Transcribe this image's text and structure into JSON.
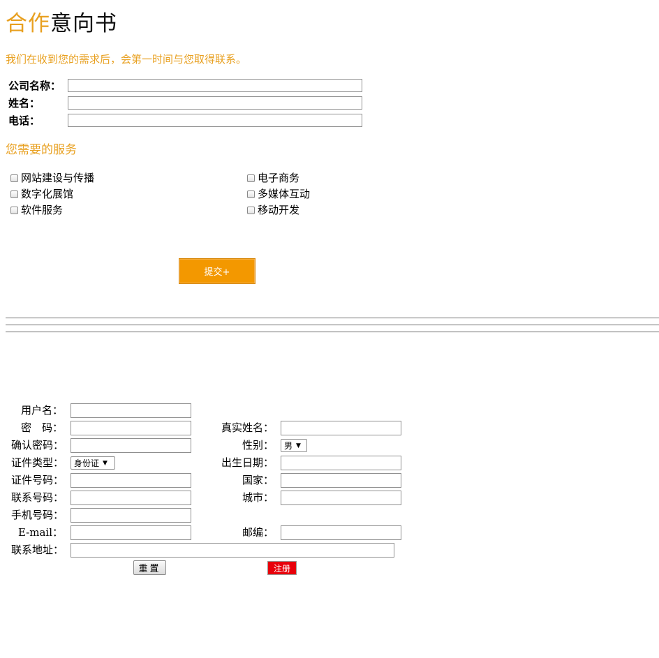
{
  "header": {
    "title_accent": "合作",
    "title_rest": "意向书",
    "subtitle": "我们在收到您的需求后，会第一时间与您取得联系。"
  },
  "contact_form": {
    "company_label": "公司名称：",
    "name_label": "姓名：",
    "phone_label": "电话：",
    "company_value": "",
    "name_value": "",
    "phone_value": ""
  },
  "services": {
    "heading": "您需要的服务",
    "options": [
      "网站建设与传播",
      "电子商务",
      "数字化展馆",
      "多媒体互动",
      "软件服务",
      "移动开发"
    ],
    "submit_label": "提交+"
  },
  "register_form": {
    "username_label": "用户名：",
    "password_label": "密　码：",
    "realname_label": "真实姓名：",
    "confirm_label": "确认密码：",
    "gender_label": "性别：",
    "gender_value": "男",
    "idtype_label": "证件类型：",
    "idtype_value": "身份证",
    "birthdate_label": "出生日期：",
    "idnumber_label": "证件号码：",
    "country_label": "国家：",
    "contactnum_label": "联系号码：",
    "city_label": "城市：",
    "mobile_label": "手机号码：",
    "email_label": "E-mail：",
    "postcode_label": "邮编：",
    "address_label": "联系地址：",
    "reset_label": "重置",
    "register_label": "注册"
  },
  "colors": {
    "accent": "#e8a020",
    "submit_button": "#f39800",
    "register_button": "#e8000b"
  }
}
